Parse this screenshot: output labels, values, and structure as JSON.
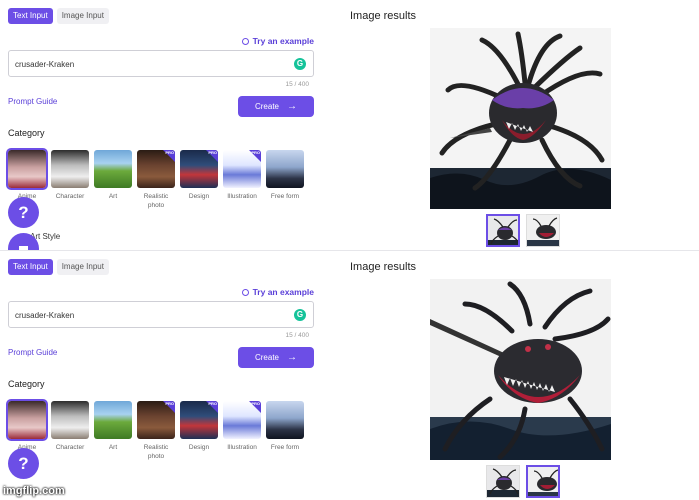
{
  "panels": [
    {
      "tabs": [
        "Text Input",
        "Image Input"
      ],
      "try_example": "Try an example",
      "prompt_value": "crusader-Kraken",
      "char_count": "15 / 400",
      "prompt_guide": "Prompt Guide",
      "create_label": "Create",
      "category_title": "Category",
      "categories": [
        {
          "label": "Anime",
          "pro": false
        },
        {
          "label": "Character",
          "pro": false
        },
        {
          "label": "Art",
          "pro": false
        },
        {
          "label": "Realistic photo",
          "pro": true
        },
        {
          "label": "Design",
          "pro": true
        },
        {
          "label": "Illustration",
          "pro": true
        },
        {
          "label": "Free form",
          "pro": false
        }
      ],
      "style_label": "Art Style",
      "results_title": "Image results",
      "selected_result": 1
    },
    {
      "tabs": [
        "Text Input",
        "Image Input"
      ],
      "try_example": "Try an example",
      "prompt_value": "crusader-Kraken",
      "char_count": "15 / 400",
      "prompt_guide": "Prompt Guide",
      "create_label": "Create",
      "category_title": "Category",
      "categories": [
        {
          "label": "Anime",
          "pro": false
        },
        {
          "label": "Character",
          "pro": false
        },
        {
          "label": "Art",
          "pro": false
        },
        {
          "label": "Realistic photo",
          "pro": true
        },
        {
          "label": "Design",
          "pro": true
        },
        {
          "label": "Illustration",
          "pro": true
        },
        {
          "label": "Free form",
          "pro": false
        }
      ],
      "results_title": "Image results",
      "selected_result": 2
    }
  ],
  "pro_badge": "PRO",
  "help_glyph": "?",
  "watermark": "imgflip.com",
  "colors": {
    "accent": "#6c4ee6",
    "grammarly": "#15c39a"
  }
}
